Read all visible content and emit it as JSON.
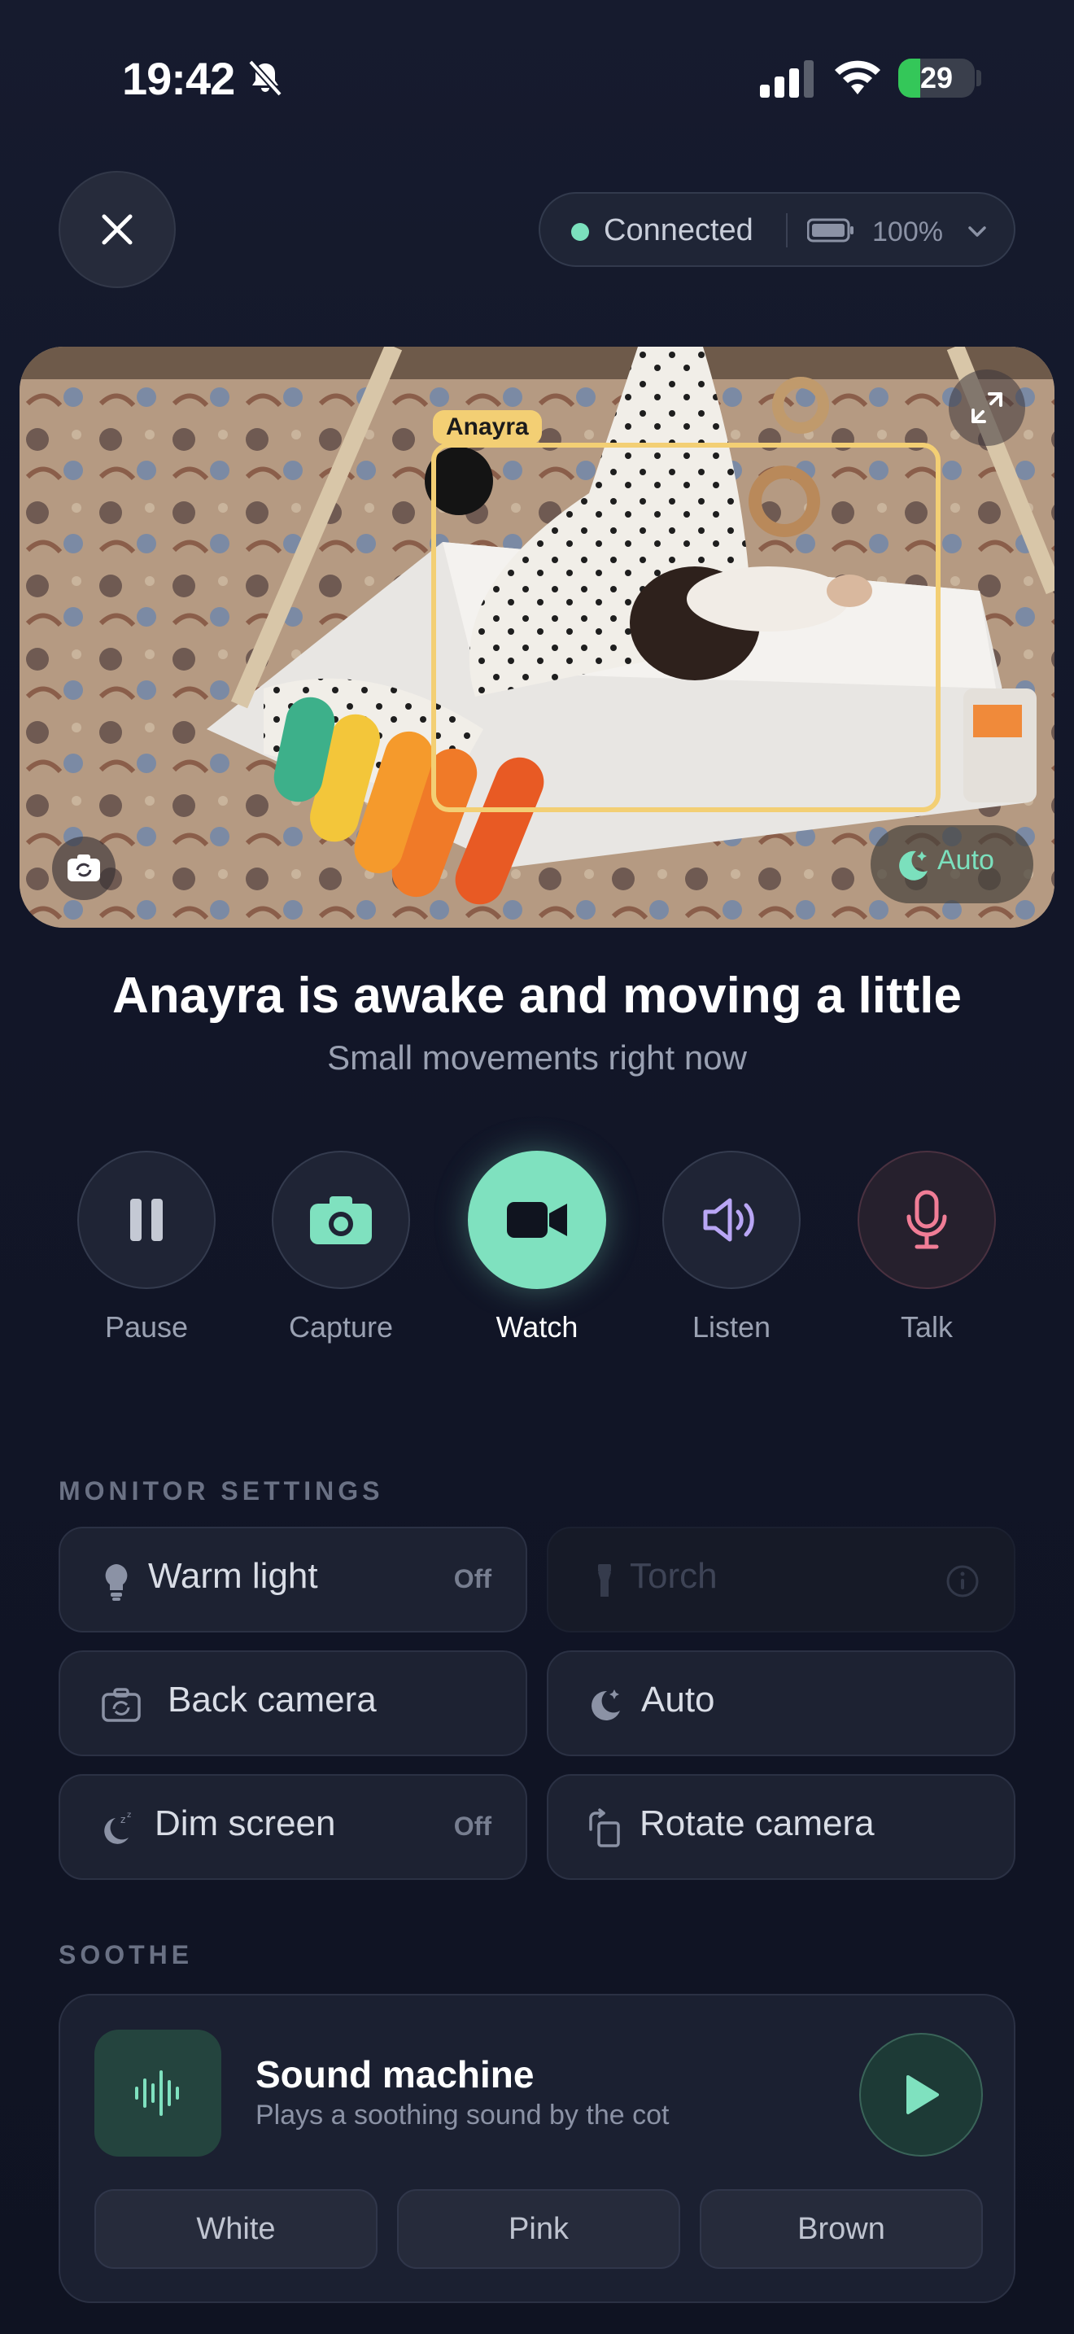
{
  "status_bar": {
    "time": "19:42",
    "battery": "29",
    "battery_level": 0.29,
    "battery_color": "#34c759"
  },
  "header": {
    "close_icon": "close-icon",
    "connection": {
      "status": "Connected",
      "status_color": "#7be0bd",
      "device_battery": "100%"
    }
  },
  "camera": {
    "tracked_name": "Anayra",
    "night_mode": "Auto",
    "box_color": "#f3cf74"
  },
  "status": {
    "title": "Anayra is awake and moving a little",
    "subtitle": "Small movements right now"
  },
  "actions": [
    {
      "label": "Pause",
      "icon": "pause-icon"
    },
    {
      "label": "Capture",
      "icon": "camera-icon"
    },
    {
      "label": "Watch",
      "icon": "video-icon",
      "active": true
    },
    {
      "label": "Listen",
      "icon": "speaker-icon"
    },
    {
      "label": "Talk",
      "icon": "microphone-icon"
    }
  ],
  "monitor_settings": {
    "heading": "MONITOR SETTINGS",
    "tiles": [
      {
        "label": "Warm light",
        "value": "Off",
        "icon": "lightbulb-icon"
      },
      {
        "label": "Torch",
        "icon": "flashlight-icon",
        "disabled": true
      },
      {
        "label": "Back camera",
        "icon": "switch-camera-icon"
      },
      {
        "label": "Auto",
        "icon": "moon-icon"
      },
      {
        "label": "Dim screen",
        "value": "Off",
        "icon": "moon-sleep-icon"
      },
      {
        "label": "Rotate camera",
        "icon": "rotate-icon"
      }
    ]
  },
  "soothe": {
    "heading": "SOOTHE",
    "title": "Sound machine",
    "subtitle": "Plays a soothing sound by the cot",
    "accent": "#7fe1bf",
    "noise_options": [
      "White",
      "Pink",
      "Brown"
    ]
  }
}
